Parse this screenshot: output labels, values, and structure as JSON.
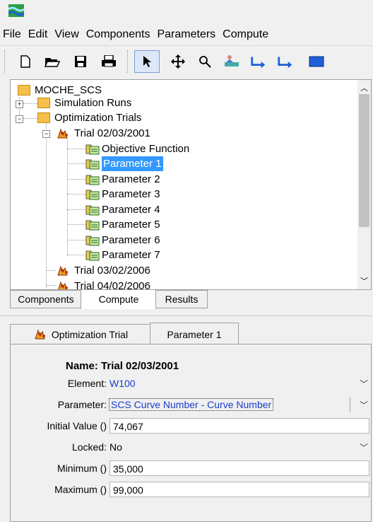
{
  "menu": [
    "File",
    "Edit",
    "View",
    "Components",
    "Parameters",
    "Compute"
  ],
  "tree": {
    "root": "MOCHE_SCS",
    "simulation_runs": "Simulation Runs",
    "optimization_trials": "Optimization Trials",
    "trial1": "Trial 02/03/2001",
    "children": [
      "Objective Function",
      "Parameter 1",
      "Parameter 2",
      "Parameter 3",
      "Parameter 4",
      "Parameter 5",
      "Parameter 6",
      "Parameter 7"
    ],
    "trial2": "Trial 03/02/2006",
    "trial3": "Trial 04/02/2006"
  },
  "bottom_tabs": [
    "Components",
    "Compute",
    "Results"
  ],
  "editor_tabs": {
    "trial": "Optimization Trial",
    "param": "Parameter 1"
  },
  "form": {
    "name_label": "Name:",
    "name_value": "Trial 02/03/2001",
    "element_label": "Element:",
    "element_value": "W100",
    "parameter_label": "Parameter:",
    "parameter_value": "SCS Curve Number - Curve Number",
    "initial_label": "Initial Value ()",
    "initial_value": "74,067",
    "locked_label": "Locked:",
    "locked_value": "No",
    "min_label": "Minimum ()",
    "min_value": "35,000",
    "max_label": "Maximum ()",
    "max_value": "99,000"
  },
  "colors": {
    "selection": "#3399ff",
    "combo_text": "#1a3ccc"
  }
}
